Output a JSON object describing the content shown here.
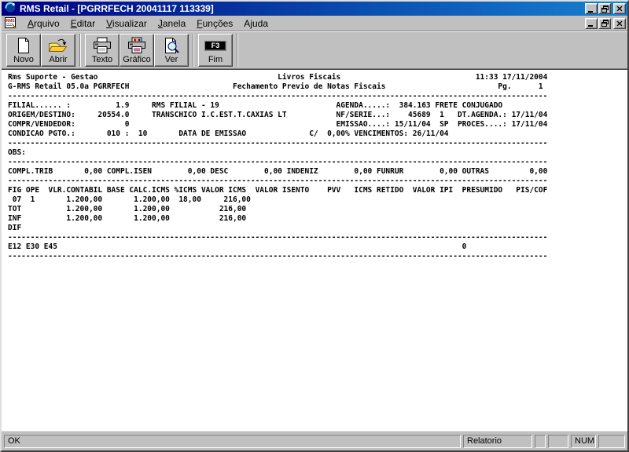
{
  "window": {
    "title": "RMS Retail - [PGRRFECH 20041117 113339]"
  },
  "menu": {
    "items": [
      {
        "pre": "",
        "key": "A",
        "post": "rquivo"
      },
      {
        "pre": "",
        "key": "E",
        "post": "ditar"
      },
      {
        "pre": "",
        "key": "V",
        "post": "isualizar"
      },
      {
        "pre": "",
        "key": "J",
        "post": "anela"
      },
      {
        "pre": "",
        "key": "F",
        "post": "unções"
      },
      {
        "pre": "A",
        "key": "j",
        "post": "uda"
      }
    ]
  },
  "toolbar": {
    "buttons": [
      {
        "label": "Novo"
      },
      {
        "label": "Abrir"
      },
      {
        "label": "Texto"
      },
      {
        "label": "Gráfico"
      },
      {
        "label": "Ver"
      },
      {
        "label": "Fim",
        "key": "F3"
      }
    ]
  },
  "report": {
    "separator": "------------------------------------------------------------------------------------------------------------------------",
    "lines": [
      "Rms Suporte - Gestao                                        Livros Fiscais                              11:33 17/11/2004",
      "G-RMS Retail 05.0a PGRRFECH                       Fechamento Previo de Notas Fiscais                         Pg.      1",
      "@SEP",
      "FILIAL...... :          1.9     RMS FILIAL - 19                          AGENDA.....:  384.163 FRETE CONJUGADO",
      "ORIGEM/DESTINO:     20554.0     TRANSCHICO I.C.EST.T.CAXIAS LT           NF/SERIE...:    45689  1   DT.AGENDA.: 17/11/04",
      "COMPR/VENDEDOR:           0                                              EMISSAO....: 15/11/04  SP  PROCES....: 17/11/04",
      "CONDICAO PGTO.:       010 :  10       DATA DE EMISSAO              C/  0,00% VENCIMENTOS: 26/11/04",
      "@SEP",
      "OBS:",
      "@SEP",
      "COMPL.TRIB       0,00 COMPL.ISEN        0,00 DESC        0,00 INDENIZ        0,00 FUNRUR        0,00 OUTRAS         0,00",
      "@SEP",
      "FIG OPE  VLR.CONTABIL BASE CALC.ICMS %ICMS VALOR ICMS  VALOR ISENTO    PVV   ICMS RETIDO  VALOR IPI  PRESUMIDO   PIS/COF",
      " 07  1       1.200,00       1.200,00  18,00     216,00",
      "TOT          1.200,00       1.200,00           216,00",
      "INF          1.200,00       1.200,00           216,00",
      "DIF",
      "@SEP",
      "E12 E30 E45                                                                                          0",
      "@SEP"
    ]
  },
  "statusbar": {
    "message": "OK",
    "panels": [
      "Relatorio",
      "",
      "",
      "NUM",
      ""
    ]
  },
  "colors": {
    "titlebar_from": "#000080",
    "titlebar_to": "#1880d0",
    "chrome": "#c0c0c0",
    "report_text": "#000000"
  }
}
